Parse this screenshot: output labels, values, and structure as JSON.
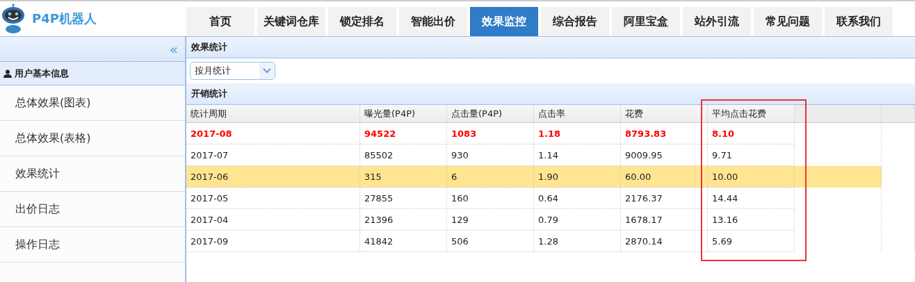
{
  "logo": {
    "title": "P4P机器人"
  },
  "nav": [
    {
      "label": "首页",
      "selected": false
    },
    {
      "label": "关键词仓库",
      "selected": false
    },
    {
      "label": "锁定排名",
      "selected": false
    },
    {
      "label": "智能出价",
      "selected": false
    },
    {
      "label": "效果监控",
      "selected": true
    },
    {
      "label": "综合报告",
      "selected": false
    },
    {
      "label": "阿里宝盒",
      "selected": false
    },
    {
      "label": "站外引流",
      "selected": false
    },
    {
      "label": "常见问题",
      "selected": false
    },
    {
      "label": "联系我们",
      "selected": false
    }
  ],
  "sidebar": {
    "collapse": "«",
    "section": "用户基本信息",
    "items": [
      "总体效果(图表)",
      "总体效果(表格)",
      "效果统计",
      "出价日志",
      "操作日志"
    ]
  },
  "panel": {
    "title": "效果统计",
    "period_select": {
      "value": "按月统计"
    }
  },
  "table": {
    "title": "开销统计",
    "columns": [
      {
        "label": "统计周期",
        "marked": false
      },
      {
        "label": "曝光量(P4P)",
        "marked": false
      },
      {
        "label": "点击量(P4P)",
        "marked": false
      },
      {
        "label": "点击率",
        "marked": false
      },
      {
        "label": "花费",
        "marked": false
      },
      {
        "label": "平均点击花费",
        "marked": true
      }
    ],
    "rows": [
      {
        "cells": [
          "2017-08",
          "94522",
          "1083",
          "1.18",
          "8793.83",
          "8.10"
        ],
        "emphasized": true,
        "selected": false
      },
      {
        "cells": [
          "2017-07",
          "85502",
          "930",
          "1.14",
          "9009.95",
          "9.71"
        ],
        "emphasized": false,
        "selected": false
      },
      {
        "cells": [
          "2017-06",
          "315",
          "6",
          "1.90",
          "60.00",
          "10.00"
        ],
        "emphasized": false,
        "selected": true
      },
      {
        "cells": [
          "2017-05",
          "27855",
          "160",
          "0.64",
          "2176.37",
          "14.44"
        ],
        "emphasized": false,
        "selected": false
      },
      {
        "cells": [
          "2017-04",
          "21396",
          "129",
          "0.79",
          "1678.17",
          "13.16"
        ],
        "emphasized": false,
        "selected": false
      },
      {
        "cells": [
          "2017-09",
          "41842",
          "506",
          "1.28",
          "2870.14",
          "5.69"
        ],
        "emphasized": false,
        "selected": false
      }
    ]
  }
}
